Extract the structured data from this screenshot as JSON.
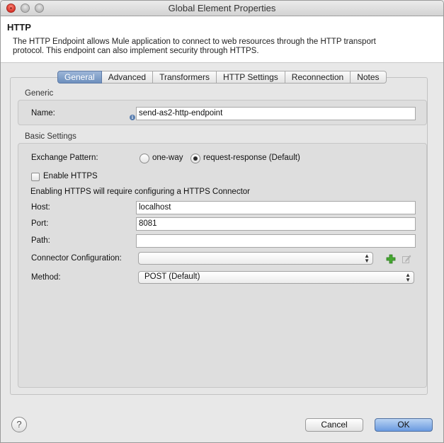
{
  "window": {
    "title": "Global Element Properties"
  },
  "header": {
    "title": "HTTP",
    "description": "The HTTP Endpoint allows Mule application to connect to web resources through the HTTP transport protocol. This endpoint can also implement security through HTTPS."
  },
  "tabs": [
    {
      "label": "General",
      "active": true
    },
    {
      "label": "Advanced",
      "active": false
    },
    {
      "label": "Transformers",
      "active": false
    },
    {
      "label": "HTTP Settings",
      "active": false
    },
    {
      "label": "Reconnection",
      "active": false
    },
    {
      "label": "Notes",
      "active": false
    }
  ],
  "generic": {
    "section_label": "Generic",
    "name_label": "Name:",
    "name_value": "send-as2-http-endpoint"
  },
  "basic": {
    "section_label": "Basic Settings",
    "exchange_pattern_label": "Exchange Pattern:",
    "exchange_options": [
      {
        "label": "one-way",
        "selected": false
      },
      {
        "label": "request-response (Default)",
        "selected": true
      }
    ],
    "enable_https_label": "Enable HTTPS",
    "enable_https_checked": false,
    "https_note": "Enabling HTTPS will require configuring a HTTPS Connector",
    "host_label": "Host:",
    "host_value": "localhost",
    "port_label": "Port:",
    "port_value": "8081",
    "path_label": "Path:",
    "path_value": "",
    "connector_label": "Connector Configuration:",
    "connector_value": "",
    "method_label": "Method:",
    "method_value": "POST (Default)"
  },
  "footer": {
    "help_symbol": "?",
    "cancel_label": "Cancel",
    "ok_label": "OK"
  },
  "icons": {
    "add_icon_color": "#3a9a2a",
    "selected_tab_color": "#6d8fbd"
  }
}
